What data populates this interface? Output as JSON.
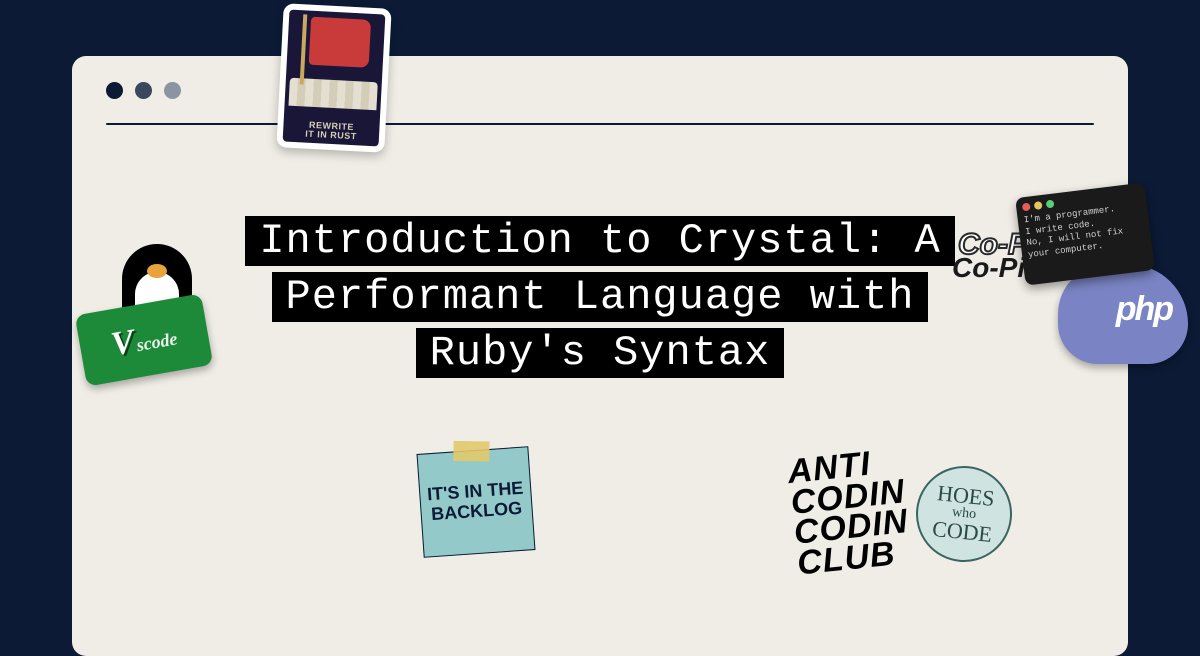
{
  "title": {
    "line1": "Introduction to Crystal: A",
    "line2": "Performant Language with",
    "line3": "Ruby's Syntax"
  },
  "stickers": {
    "rust": {
      "line1": "REWRITE",
      "line2": "IT IN RUST"
    },
    "vscode": {
      "main": "V",
      "sub": "scode"
    },
    "backlog": "IT'S IN THE BACKLOG",
    "anti": {
      "l1": "ANTI",
      "l2": "CODIN",
      "l3": "CODIN",
      "l4": "CLUB"
    },
    "hoes": {
      "top": "HOES",
      "mid": "who",
      "bot": "CODE"
    },
    "copilot": {
      "top": "Co-Pil",
      "bottom": "Co-Pi"
    },
    "php": "php",
    "terminal": {
      "l1": "I'm a programmer.",
      "l2": "I write code.",
      "l3": "No, I will not fix",
      "l4": "your computer."
    }
  }
}
